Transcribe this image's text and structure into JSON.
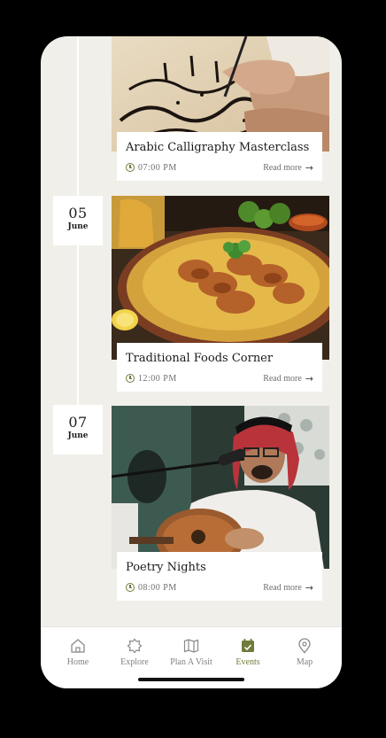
{
  "events": [
    {
      "title": "Arabic Calligraphy Masterclass",
      "time": "07:00 PM",
      "read_more": "Read more"
    },
    {
      "day": "05",
      "month": "June",
      "title": "Traditional Foods Corner",
      "time": "12:00 PM",
      "read_more": "Read more"
    },
    {
      "day": "07",
      "month": "June",
      "title": "Poetry Nights",
      "time": "08:00 PM",
      "read_more": "Read more"
    }
  ],
  "nav": {
    "items": [
      {
        "label": "Home",
        "icon": "home-icon"
      },
      {
        "label": "Explore",
        "icon": "explore-icon"
      },
      {
        "label": "Plan A Visit",
        "icon": "map-fold-icon"
      },
      {
        "label": "Events",
        "icon": "calendar-icon"
      },
      {
        "label": "Map",
        "icon": "location-pin-icon"
      }
    ],
    "active": "Events"
  },
  "colors": {
    "accent": "#6f7c3c",
    "background": "#f1efea",
    "text": "#1a1a1a",
    "muted": "#808080"
  }
}
